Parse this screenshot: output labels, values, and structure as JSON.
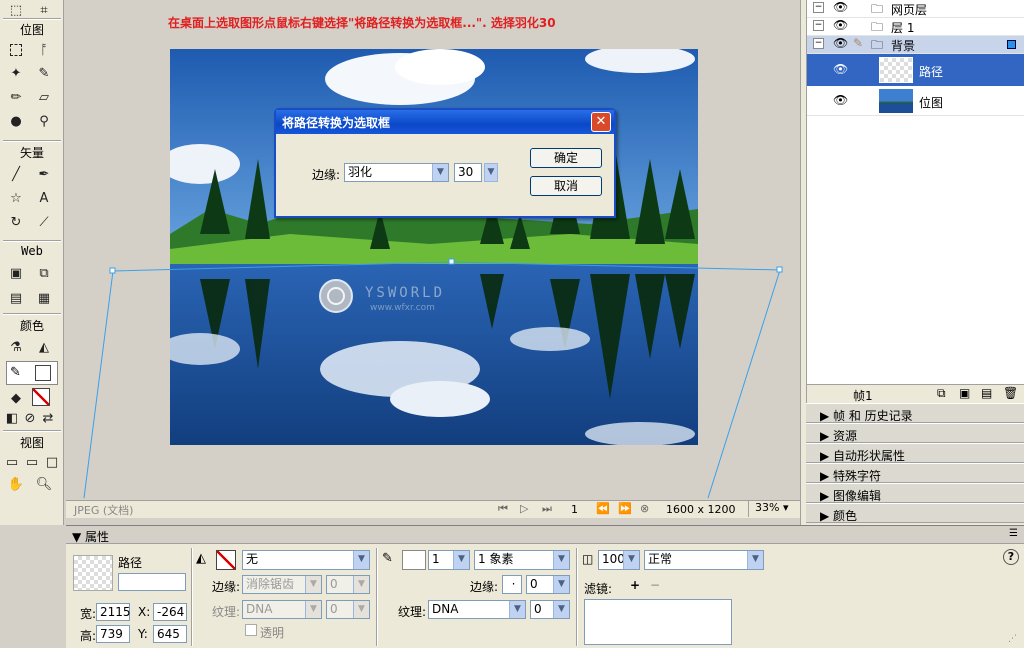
{
  "instruction": "在桌面上选取图形点鼠标右键选择\"将路径转换为选取框...\". 选择羽化30",
  "tools": {
    "bitmap_title": "位图",
    "vector_title": "矢量",
    "web_title": "Web",
    "color_title": "颜色",
    "view_title": "视图"
  },
  "document": {
    "file_label": "JPEG (文档)",
    "frame_number": "1",
    "size_label": "1600 x 1200",
    "zoom": "33%",
    "watermark": "YSWORLD",
    "watermark_url": "www.wfxr.com"
  },
  "dialog": {
    "title": "将路径转换为选取框",
    "edge_label": "边缘:",
    "edge_value": "羽化",
    "amount_value": "30",
    "ok_label": "确定",
    "cancel_label": "取消"
  },
  "layers": {
    "rows": [
      {
        "name": "网页层"
      },
      {
        "name": "层 1"
      },
      {
        "name": "背景"
      },
      {
        "name": "路径"
      },
      {
        "name": "位图"
      }
    ],
    "frame_label": "帧1"
  },
  "panels": [
    "帧 和 历史记录",
    "资源",
    "自动形状属性",
    "特殊字符",
    "图像编辑",
    "颜色"
  ],
  "properties": {
    "header": "属性",
    "object_name": "路径",
    "object_name_input": "",
    "width_label": "宽:",
    "width_value": "2115",
    "height_label": "高:",
    "height_value": "739",
    "x_label": "X:",
    "x_value": "-264",
    "y_label": "Y:",
    "y_value": "645",
    "fill_value": "无",
    "edge_label": "边缘:",
    "edge_value": "消除锯齿",
    "edge_amount": "0",
    "texture_label": "纹理:",
    "texture_value": "DNA",
    "texture_amount": "0",
    "transparent_label": "透明",
    "stroke_size": "1",
    "stroke_type": "1 象素",
    "stroke_edge_label": "边缘:",
    "stroke_edge_value": "0",
    "stroke_texture_label": "纹理:",
    "stroke_texture_value": "DNA",
    "stroke_texture_amount": "0",
    "opacity": "100",
    "blend_mode": "正常",
    "filters_label": "滤镜:",
    "help": "?"
  }
}
